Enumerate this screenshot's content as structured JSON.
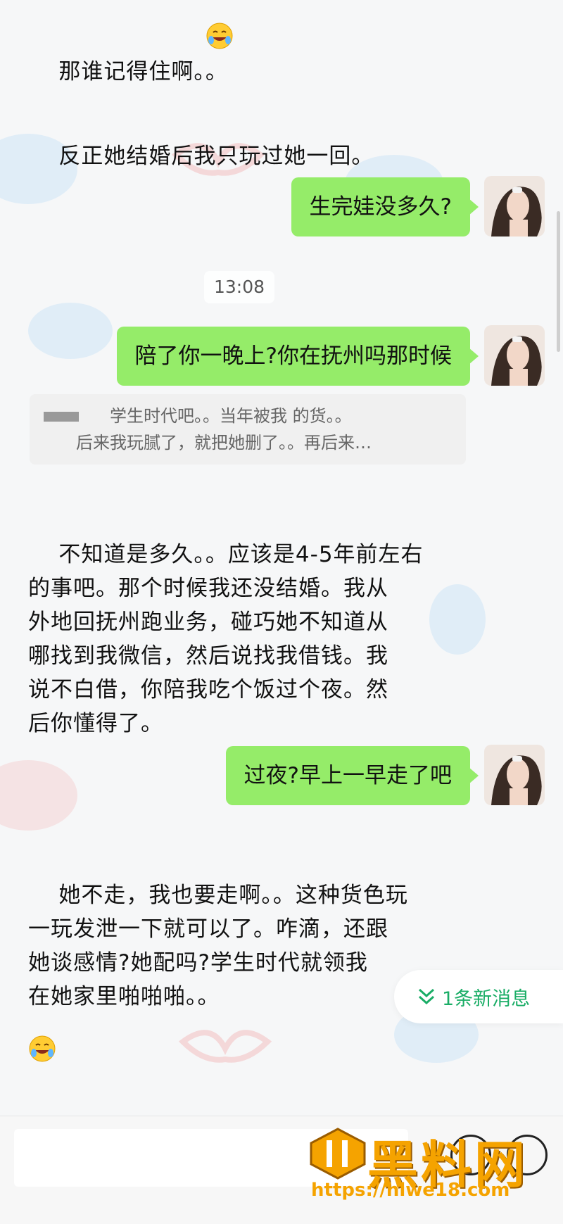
{
  "messages": {
    "m1": "那谁记得住啊。。",
    "m2": "反正她结婚后我只玩过她一回。",
    "m3": "生完娃没多久?",
    "time": "13:08",
    "m4": "陪了你一晚上?你在抚州吗那时候",
    "quote_line1": "学生时代吧。。当年被我  的货。。",
    "quote_line2": "后来我玩腻了，就把她删了。。再后来…",
    "m5": "不知道是多久。。应该是4-5年前左右\n的事吧。那个时候我还没结婚。我从\n外地回抚州跑业务，碰巧她不知道从\n哪找到我微信，然后说找我借钱。我\n说不白借，你陪我吃个饭过个夜。然\n后你懂得了。",
    "m6": "过夜?早上一早走了吧",
    "m7": "她不走，我也要走啊。。这种货色玩\n一玩发泄一下就可以了。咋滴，还跟\n她谈感情?她配吗?学生时代就领我\n在她家里啪啪啪。。"
  },
  "new_messages": {
    "label": "1条新消息",
    "icon": "double-chevron-down-icon"
  },
  "watermark": {
    "title": "黑料网",
    "url": "https://hlwe18.com"
  },
  "colors": {
    "bubble_green": "#95ec69",
    "accent_green": "#1aad66",
    "watermark_orange": "#f5a300"
  }
}
